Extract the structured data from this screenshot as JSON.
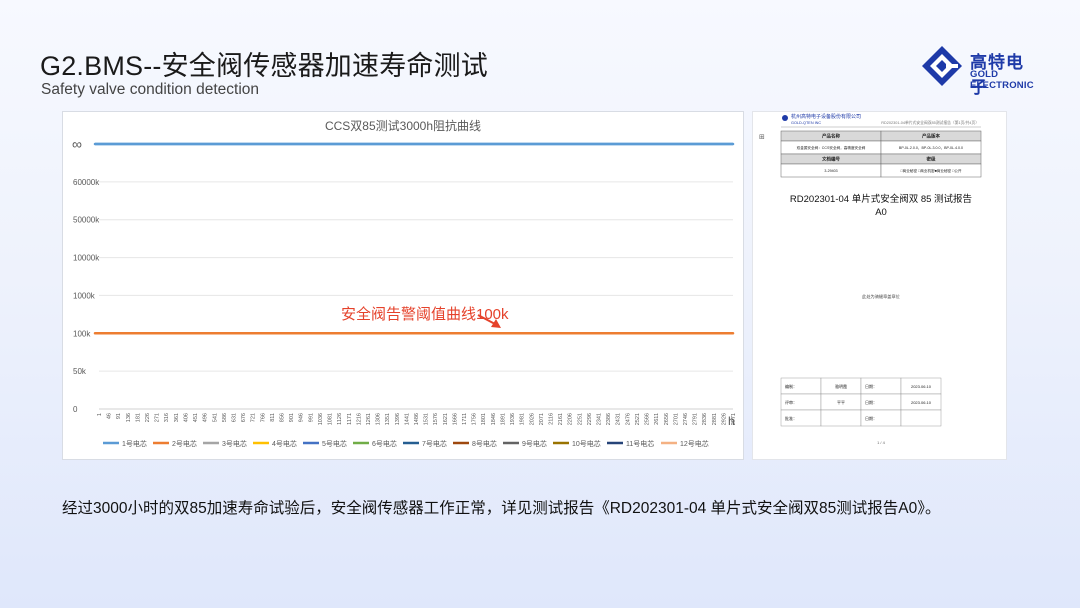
{
  "slide": {
    "title": "G2.BMS--安全阀传感器加速寿命测试",
    "subtitle": "Safety valve condition detection",
    "footer": "经过3000小时的双85加速寿命试验后，安全阀传感器工作正常，详见测试报告《RD202301-04 单片式安全阀双85测试报告A0》。"
  },
  "logo": {
    "cn": "高特电子",
    "en": "GOLD ELECTRONIC",
    "color": "#1e3aa8"
  },
  "chart_data": {
    "type": "line",
    "title": "CCS双85测试3000h阻抗曲线",
    "xlabel": "h",
    "ylabel": "",
    "y_tick_labels": [
      "0",
      "50k",
      "100k",
      "1000k",
      "10000k",
      "50000k",
      "60000k",
      "∞"
    ],
    "x": [
      1,
      46,
      91,
      136,
      181,
      226,
      271,
      316,
      361,
      406,
      451,
      496,
      541,
      586,
      631,
      676,
      721,
      766,
      811,
      856,
      901,
      946,
      991,
      1036,
      1081,
      1126,
      1171,
      1216,
      1261,
      1306,
      1351,
      1396,
      1441,
      1486,
      1531,
      1576,
      1621,
      1666,
      1711,
      1756,
      1801,
      1846,
      1891,
      1936,
      1981,
      2026,
      2071,
      2116,
      2161,
      2206,
      2251,
      2296,
      2341,
      2386,
      2431,
      2476,
      2521,
      2566,
      2611,
      2656,
      2701,
      2746,
      2791,
      2836,
      2881,
      2926,
      2971
    ],
    "series": [
      {
        "name": "1号电芯",
        "color": "#5b9bd5",
        "value": "∞"
      },
      {
        "name": "2号电芯",
        "color": "#ed7d31",
        "value": "100k"
      },
      {
        "name": "3号电芯",
        "color": "#a5a5a5",
        "value": "∞"
      },
      {
        "name": "4号电芯",
        "color": "#ffc000",
        "value": "∞"
      },
      {
        "name": "5号电芯",
        "color": "#4472c4",
        "value": "∞"
      },
      {
        "name": "6号电芯",
        "color": "#70ad47",
        "value": "∞"
      },
      {
        "name": "7号电芯",
        "color": "#255e91",
        "value": "∞"
      },
      {
        "name": "8号电芯",
        "color": "#9e480e",
        "value": "∞"
      },
      {
        "name": "9号电芯",
        "color": "#636363",
        "value": "∞"
      },
      {
        "name": "10号电芯",
        "color": "#997300",
        "value": "∞"
      },
      {
        "name": "11号电芯",
        "color": "#264478",
        "value": "∞"
      },
      {
        "name": "12号电芯",
        "color": "#f4b183",
        "value": "∞"
      }
    ],
    "annotation": {
      "text": "安全阀告警阈值曲线100k",
      "color": "#e5422b",
      "value": "100k"
    },
    "grid": true,
    "legend": "bottom"
  },
  "report": {
    "company": "杭州高特电子设备股份有限公司",
    "company_en": "GOLD-QTEN INC",
    "header_right": "RD202301-04单片式安全阀双85测试报告（第1页/共4页）",
    "table": {
      "row1": [
        "产品名称",
        "产品版本"
      ],
      "row2": [
        "双金属安全阀：CCS安全阀，高精度安全阀",
        "BP-0L.2.0.0，BP-0L.3.0.0，BP-0L.4.0.0"
      ],
      "row3": [
        "文档编号",
        "密级"
      ],
      "row4": [
        "3-29403",
        "□商业秘密 □商业机密■商业秘密 □公开"
      ]
    },
    "title": "RD202301-04 单片式安全阀双 85 测试报告",
    "version": "A0",
    "middle_text": "此处为骑缝章盖章位",
    "sig_table": [
      [
        "编制：",
        "骆明霞",
        "日期：",
        "2023.06.10"
      ],
      [
        "评审：",
        "平平",
        "日期：",
        "2023.06.10"
      ],
      [
        "批准：",
        "",
        "日期：",
        ""
      ]
    ],
    "page": "1 / 4"
  }
}
